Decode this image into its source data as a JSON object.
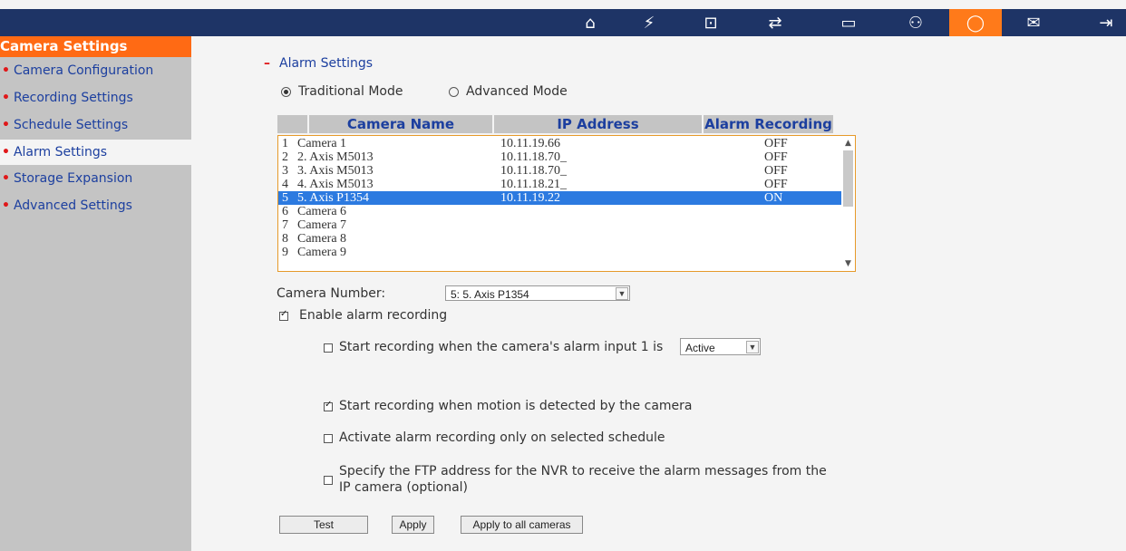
{
  "sidebar": {
    "title": "Camera Settings",
    "items": [
      {
        "label": "Camera Configuration"
      },
      {
        "label": "Recording Settings"
      },
      {
        "label": "Schedule Settings"
      },
      {
        "label": "Alarm Settings"
      },
      {
        "label": "Storage Expansion"
      },
      {
        "label": "Advanced Settings"
      }
    ]
  },
  "section": {
    "title": "Alarm Settings"
  },
  "modes": {
    "traditional": "Traditional Mode",
    "advanced": "Advanced Mode"
  },
  "table": {
    "headers": [
      "Camera Name",
      "IP Address",
      "Alarm Recording"
    ],
    "rows": [
      {
        "num": "1",
        "name": "Camera 1",
        "ip": "10.11.19.66",
        "alarm": "OFF"
      },
      {
        "num": "2",
        "name": "2. Axis M5013",
        "ip": "10.11.18.70_",
        "alarm": "OFF"
      },
      {
        "num": "3",
        "name": "3. Axis M5013",
        "ip": "10.11.18.70_",
        "alarm": "OFF"
      },
      {
        "num": "4",
        "name": "4. Axis M5013",
        "ip": "10.11.18.21_",
        "alarm": "OFF"
      },
      {
        "num": "5",
        "name": "5. Axis P1354",
        "ip": "10.11.19.22",
        "alarm": "ON"
      },
      {
        "num": "6",
        "name": "Camera 6",
        "ip": "",
        "alarm": ""
      },
      {
        "num": "7",
        "name": "Camera 7",
        "ip": "",
        "alarm": ""
      },
      {
        "num": "8",
        "name": "Camera 8",
        "ip": "",
        "alarm": ""
      },
      {
        "num": "9",
        "name": "Camera 9",
        "ip": "",
        "alarm": ""
      }
    ]
  },
  "camera_number": {
    "label": "Camera Number:",
    "value": "5: 5. Axis P1354"
  },
  "enable_alarm": {
    "label": "Enable alarm recording"
  },
  "options": {
    "alarm_input": "Start recording when the camera's alarm input 1 is",
    "alarm_input_value": "Active",
    "motion": "Start recording when motion is detected by the camera",
    "schedule": "Activate alarm recording only on selected schedule",
    "ftp_line1": "Specify the FTP address for the NVR to receive the alarm messages from the",
    "ftp_line2": "IP camera (optional)"
  },
  "buttons": {
    "test": "Test",
    "apply": "Apply",
    "apply_all": "Apply to all cameras"
  },
  "toolbar": {
    "icons": [
      "home-icon",
      "quick-config-icon",
      "system-settings-icon",
      "network-icon",
      "storage-icon",
      "users-icon",
      "camera-settings-icon",
      "mail-icon",
      "logout-icon"
    ]
  },
  "colors": {
    "topbar": "#1e3466",
    "accent": "#ff6a14",
    "link": "#1c3f9f",
    "selection": "#2c7ae0"
  }
}
